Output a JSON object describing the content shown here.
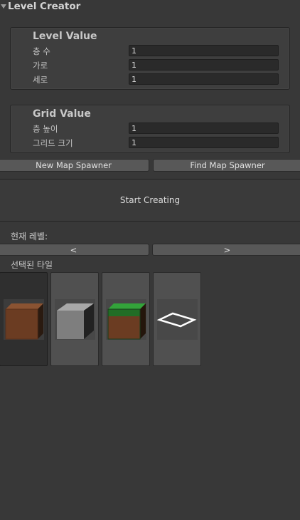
{
  "header": {
    "title": "Level Creator"
  },
  "level_value": {
    "title": "Level Value",
    "fields": [
      {
        "label": "층 수",
        "value": "1"
      },
      {
        "label": "가로",
        "value": "1"
      },
      {
        "label": "세로",
        "value": "1"
      }
    ]
  },
  "grid_value": {
    "title": "Grid Value",
    "fields": [
      {
        "label": "층 높이",
        "value": "1"
      },
      {
        "label": "그리드 크기",
        "value": "1"
      }
    ]
  },
  "buttons": {
    "new_map_spawner": "New Map Spawner",
    "find_map_spawner": "Find Map Spawner",
    "start_creating": "Start Creating",
    "prev_level": "<",
    "next_level": ">"
  },
  "current_level": {
    "label": "현재 레벨:"
  },
  "selected_tile": {
    "label": "선택된 타일"
  },
  "tiles": [
    {
      "icon": "dirt-cube-icon",
      "selected": true
    },
    {
      "icon": "stone-cube-icon",
      "selected": false
    },
    {
      "icon": "grass-cube-icon",
      "selected": false
    },
    {
      "icon": "empty-tile-icon",
      "selected": false
    }
  ],
  "colors": {
    "background": "#383838",
    "button": "#585858",
    "dirt": "#6b3c22",
    "stone": "#808080",
    "grass": "#2e8a2e"
  }
}
